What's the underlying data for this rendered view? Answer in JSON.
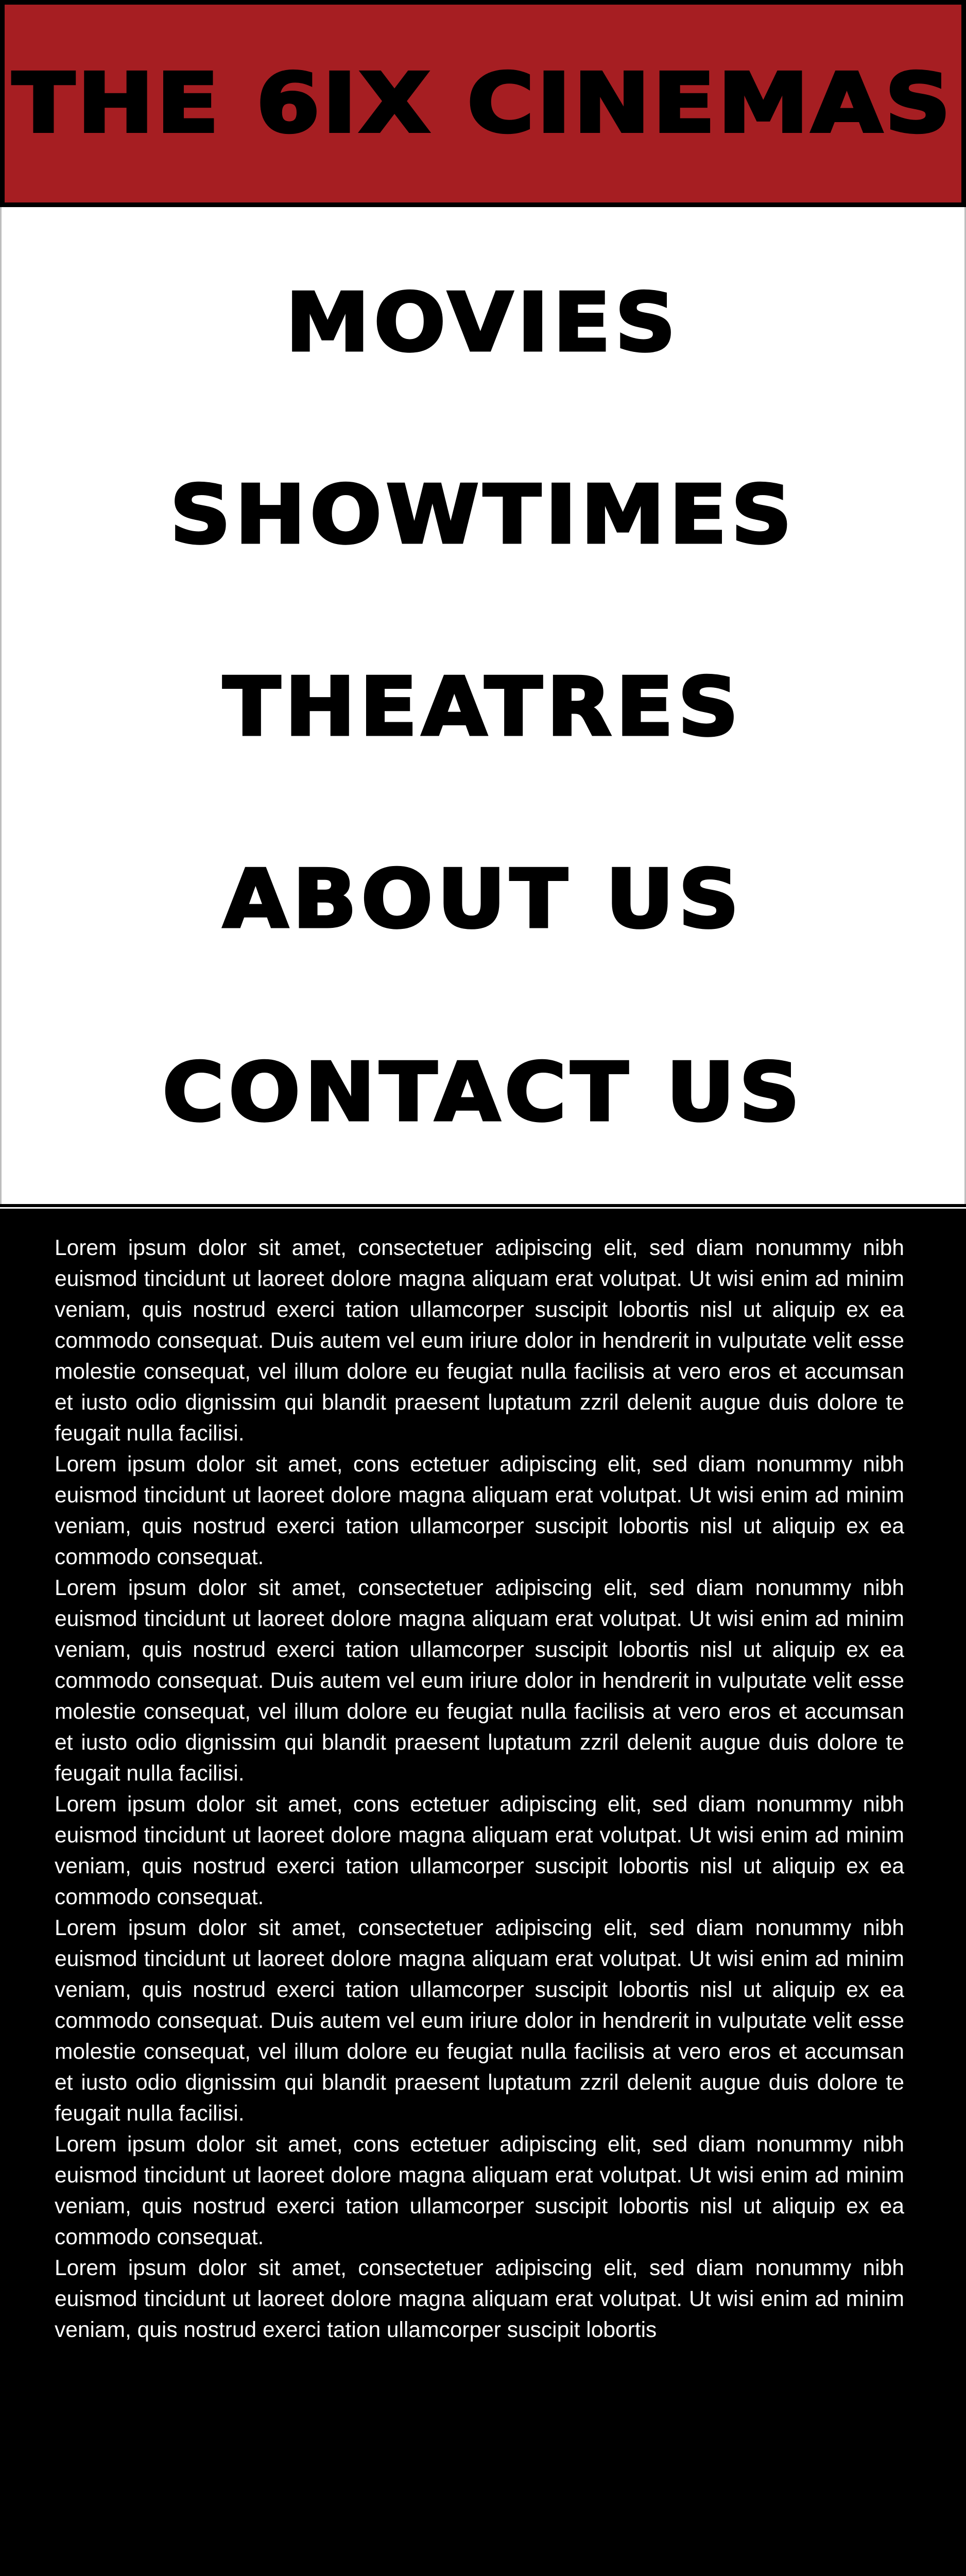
{
  "header": {
    "title": "THE 6IX CINEMAS",
    "background_color": "#a61e22"
  },
  "nav": {
    "items": [
      {
        "label": "MOVIES"
      },
      {
        "label": "SHOWTIMES"
      },
      {
        "label": "THEATRES"
      },
      {
        "label": "ABOUT US"
      },
      {
        "label": "CONTACT US"
      }
    ]
  },
  "content": {
    "background_color": "#000000",
    "paragraphs": [
      "Lorem ipsum dolor sit amet, consectetuer adipiscing elit, sed diam nonummy nibh euismod tincidunt ut laoreet dolore magna aliquam erat volutpat. Ut wisi enim ad minim veniam, quis nostrud exerci tation ullamcorper suscipit lobortis nisl ut aliquip ex ea commodo consequat. Duis autem vel eum iriure dolor in hendrerit in vulputate velit esse molestie consequat, vel illum dolore eu feugiat nulla facilisis at vero eros et accumsan et iusto odio dignissim qui blandit praesent luptatum zzril delenit augue duis dolore te feugait nulla facilisi.",
      "Lorem ipsum dolor sit amet, cons ectetuer adipiscing elit, sed diam nonummy nibh euismod tincidunt ut laoreet dolore magna aliquam erat volutpat. Ut wisi enim ad minim veniam, quis nostrud exerci tation ullamcorper suscipit lobortis nisl ut aliquip ex ea commodo consequat.",
      "Lorem ipsum dolor sit amet, consectetuer adipiscing elit, sed diam nonummy nibh euismod tincidunt ut laoreet dolore magna aliquam erat volutpat. Ut wisi enim ad minim veniam, quis nostrud exerci tation ullamcorper suscipit lobortis nisl ut aliquip ex ea commodo consequat. Duis autem vel eum iriure dolor in hendrerit in vulputate velit esse molestie consequat, vel illum dolore eu feugiat nulla facilisis at vero eros et accumsan et iusto odio dignissim qui blandit praesent luptatum zzril delenit augue duis dolore te feugait nulla facilisi.",
      "Lorem ipsum dolor sit amet, cons ectetuer adipiscing elit, sed diam nonummy nibh euismod tincidunt ut laoreet dolore magna aliquam erat volutpat. Ut wisi enim ad minim veniam, quis nostrud exerci tation ullamcorper suscipit lobortis nisl ut aliquip ex ea commodo consequat.",
      "Lorem ipsum dolor sit amet, consectetuer adipiscing elit, sed diam nonummy nibh euismod tincidunt ut laoreet dolore magna aliquam erat volutpat. Ut wisi enim ad minim veniam, quis nostrud exerci tation ullamcorper suscipit lobortis nisl ut aliquip ex ea commodo consequat. Duis autem vel eum iriure dolor in hendrerit in vulputate velit esse molestie consequat, vel illum dolore eu feugiat nulla facilisis at vero eros et accumsan et iusto odio dignissim qui blandit praesent luptatum zzril delenit augue duis dolore te feugait nulla facilisi.",
      "Lorem ipsum dolor sit amet, cons ectetuer adipiscing elit, sed diam nonummy nibh euismod tincidunt ut laoreet dolore magna aliquam erat volutpat. Ut wisi enim ad minim veniam, quis nostrud exerci tation ullamcorper suscipit lobortis nisl ut aliquip ex ea commodo consequat.",
      "Lorem ipsum dolor sit amet, consectetuer adipiscing elit, sed diam nonummy nibh euismod tincidunt ut laoreet dolore magna aliquam erat volutpat. Ut wisi enim ad minim veniam, quis nostrud exerci tation ullamcorper suscipit lobortis"
    ]
  }
}
